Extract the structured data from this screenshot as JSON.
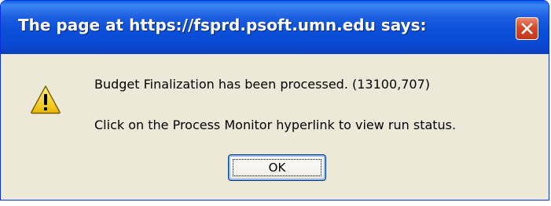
{
  "window": {
    "title": "The page at https://fsprd.psoft.umn.edu says:",
    "close_icon": "close-x-icon"
  },
  "dialog": {
    "icon": "warning-icon",
    "message_primary": "Budget Finalization has been processed. (13100,707)",
    "message_secondary": "Click on the Process Monitor hyperlink to view run status.",
    "ok_label": "OK"
  },
  "colors": {
    "titlebar": "#0b4fd8",
    "body": "#ece9d8",
    "close_button": "#d6482a",
    "warning": "#f5d51c"
  }
}
